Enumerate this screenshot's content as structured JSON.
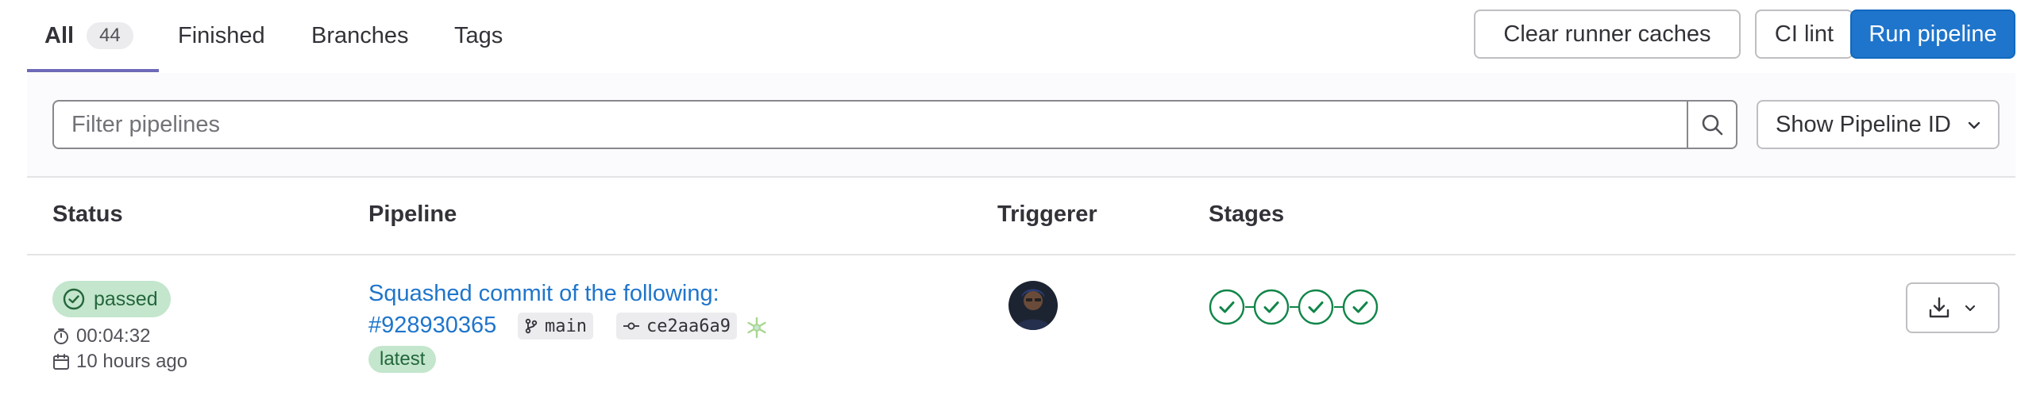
{
  "tabs": [
    {
      "label": "All",
      "count": "44",
      "active": true
    },
    {
      "label": "Finished"
    },
    {
      "label": "Branches"
    },
    {
      "label": "Tags"
    }
  ],
  "actions": {
    "clear_caches": "Clear runner caches",
    "ci_lint": "CI lint",
    "run_pipeline": "Run pipeline"
  },
  "filter": {
    "placeholder": "Filter pipelines",
    "display_select": "Show Pipeline ID"
  },
  "table": {
    "headers": [
      "Status",
      "Pipeline",
      "Triggerer",
      "Stages"
    ],
    "rows": [
      {
        "status": "passed",
        "duration": "00:04:32",
        "finished": "10 hours ago",
        "commit_title_line1": "Squashed commit of the following:",
        "commit_title_line2": "#928930365",
        "ref": "main",
        "sha": "ce2aa6a9",
        "tag": "latest",
        "stages": [
          "passed",
          "passed",
          "passed",
          "passed"
        ]
      }
    ]
  },
  "colors": {
    "primary": "#1f75cb",
    "success": "#108548",
    "success_bg": "#c3e6cd",
    "tab_underline": "#6e6ab8"
  },
  "icons": [
    "search-icon",
    "chevron-down-icon",
    "check-circle-icon",
    "timer-icon",
    "calendar-icon",
    "branch-icon",
    "commit-icon",
    "snowflake-icon",
    "download-icon"
  ]
}
